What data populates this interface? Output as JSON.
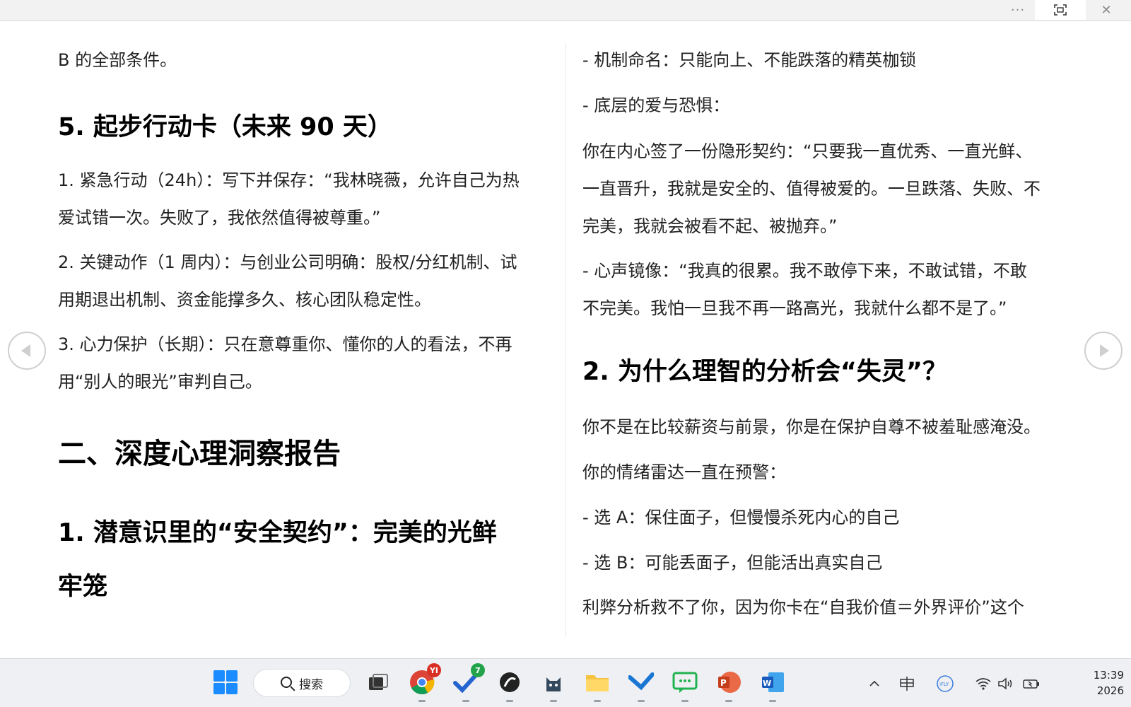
{
  "window": {
    "more_icon": "···",
    "fullscreen_icon": "⛶",
    "close_icon": "✕"
  },
  "left_page": {
    "lines": [
      "B 的全部条件。",
      "5. 起步行动卡（未来 90 天）",
      "1. 紧急行动（24h）：写下并保存：“我林晓薇，允许自己为热",
      "爱试错一次。失败了，我依然值得被尊重。”",
      "2. 关键动作（1 周内）：与创业公司明确：股权/分红机制、试",
      "用期退出机制、资金能撑多久、核心团队稳定性。",
      "3. 心力保护（长期）：只在意尊重你、懂你的人的看法，不再",
      "用“别人的眼光”审判自己。",
      "二、深度心理洞察报告",
      "1. 潜意识里的“安全契约”：完美的光鲜",
      "牢笼"
    ]
  },
  "right_page": {
    "lines": [
      " - 机制命名：只能向上、不能跌落的精英枷锁",
      " - 底层的爱与恐惧：",
      "  你在内心签了一份隐形契约：“只要我一直优秀、一直光鲜、",
      "一直晋升，我就是安全的、值得被爱的。一旦跌落、失败、不",
      "完美，我就会被看不起、被抛弃。”",
      " -  心声镜像：“我真的很累。我不敢停下来，不敢试错，不敢",
      "不完美。我怕一旦我不再一路高光，我就什么都不是了。”",
      "2. 为什么理智的分析会“失灵”？",
      "你不是在比较薪资与前景，你是在保护自尊不被羞耻感淹没。",
      "你的情绪雷达一直在预警：",
      " - 选 A：保住面子，但慢慢杀死内心的自己",
      " - 选 B：可能丢面子，但能活出真实自己",
      "利弊分析救不了你，因为你卡在“自我价值＝外界评价”这个"
    ]
  },
  "taskbar": {
    "search_label": "搜索",
    "chrome_badge": "YI",
    "todo_badge": "7",
    "clock_time": "13:39",
    "clock_date": "2026"
  }
}
